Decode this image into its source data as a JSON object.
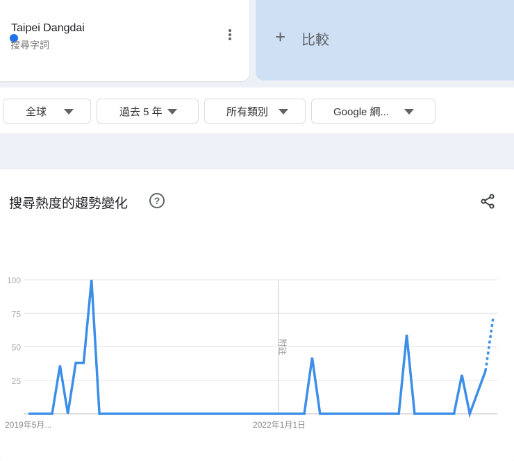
{
  "term": {
    "name": "Taipei Dangdai",
    "subtitle": "搜尋字詞",
    "color": "#1a73e8"
  },
  "compare": {
    "icon": "plus-icon",
    "label": "比較"
  },
  "filters": [
    {
      "label": "全球"
    },
    {
      "label": "過去 5 年"
    },
    {
      "label": "所有類別"
    },
    {
      "label": "Google 網..."
    }
  ],
  "chart_section": {
    "title": "搜尋熱度的趨勢變化",
    "help_icon": "help-circle-icon",
    "help_glyph": "?",
    "share_icon": "share-icon"
  },
  "chart_data": {
    "type": "line",
    "title": "搜尋熱度的趨勢變化",
    "ylim": [
      0,
      100
    ],
    "xlim": [
      0,
      59.5
    ],
    "yticks": [
      {
        "v": 100,
        "label": "100"
      },
      {
        "v": 75,
        "label": "75"
      },
      {
        "v": 50,
        "label": "50"
      },
      {
        "v": 25,
        "label": "25"
      }
    ],
    "xticks": [
      {
        "v": 0,
        "label": "2019年5月..."
      },
      {
        "v": 32,
        "label": "2022年1月1日"
      }
    ],
    "annotation": {
      "v": 31.7,
      "label": "附註"
    },
    "grid": true,
    "series": [
      {
        "name": "Taipei Dangdai",
        "color": "#3d8ee8",
        "x": [
          0,
          3,
          4,
          5,
          6,
          7,
          8,
          9,
          35,
          36,
          37,
          47,
          48,
          49,
          54,
          55,
          56,
          58,
          59
        ],
        "values": [
          0,
          0,
          36,
          0,
          38,
          38,
          100,
          0,
          0,
          42,
          0,
          0,
          59,
          0,
          0,
          29,
          0,
          32,
          73
        ],
        "partial_from_index": 17
      }
    ]
  }
}
